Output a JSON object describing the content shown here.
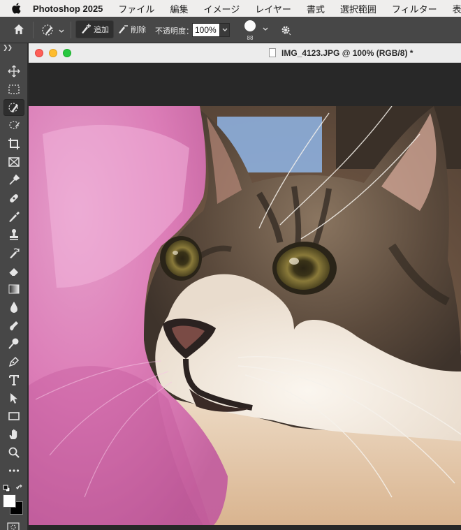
{
  "menubar": {
    "apple_icon": "apple-logo-icon",
    "app_name": "Photoshop 2025",
    "items": [
      "ファイル",
      "編集",
      "イメージ",
      "レイヤー",
      "書式",
      "選択範囲",
      "フィルター",
      "表示"
    ]
  },
  "options_bar": {
    "home_icon": "home-icon",
    "tool_preset_icon": "quick-mask-brush-icon",
    "add_label": "追加",
    "remove_label": "削除",
    "opacity_label": "不透明度：",
    "opacity_value": "100%",
    "brush_size": "88",
    "settings_icon": "gear-icon"
  },
  "document": {
    "title": "IMG_4123.JPG @ 100% (RGB/8) *",
    "zoom": "100%",
    "color_mode": "RGB/8",
    "mask_overlay_color": "#e066b0"
  },
  "tools": [
    "move-tool-icon",
    "marquee-tool-icon",
    "object-selection-brush-icon",
    "lasso-tool-icon",
    "crop-tool-icon",
    "frame-tool-icon",
    "eyedropper-tool-icon",
    "healing-brush-icon",
    "brush-tool-icon",
    "clone-stamp-icon",
    "history-brush-icon",
    "eraser-tool-icon",
    "gradient-tool-icon",
    "blur-tool-icon",
    "smudge-tool-icon",
    "dodge-tool-icon",
    "pen-tool-icon",
    "type-tool-icon",
    "path-selection-icon",
    "rectangle-tool-icon",
    "hand-tool-icon",
    "zoom-tool-icon",
    "more-tools-icon"
  ],
  "colors": {
    "foreground": "#ffffff",
    "background": "#000000"
  }
}
